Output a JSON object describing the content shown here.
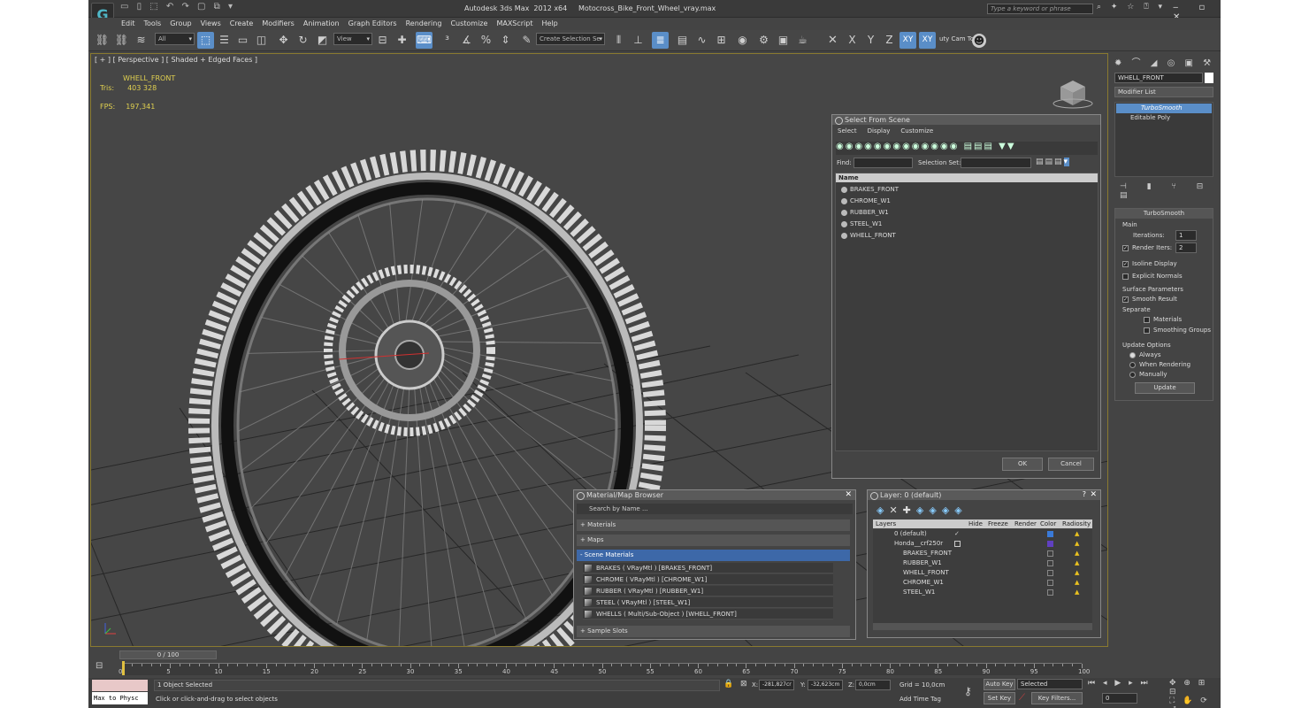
{
  "window": {
    "title": "Autodesk 3ds Max  2012 x64     Motocross_Bike_Front_Wheel_vray.max",
    "search_placeholder": "Type a keyword or phrase"
  },
  "menu": [
    "Edit",
    "Tools",
    "Group",
    "Views",
    "Create",
    "Modifiers",
    "Animation",
    "Graph Editors",
    "Rendering",
    "Customize",
    "MAXScript",
    "Help"
  ],
  "toolbar": {
    "filter": "All",
    "ref_coord": "View",
    "selection_set": "Create Selection Se",
    "axis": {
      "x": "X",
      "y": "Y",
      "z": "Z",
      "xy": "XY",
      "xy2": "XY"
    },
    "plugin_label": "uty Cam Tool"
  },
  "viewport": {
    "label": "[ + ] [ Perspective ] [ Shaded + Edged Faces ]",
    "object_name": "WHELL_FRONT",
    "tris_label": "Tris:",
    "tris_value": "403 328",
    "fps_label": "FPS:",
    "fps_value": "197,341"
  },
  "command_panel": {
    "object_name": "WHELL_FRONT",
    "modifier_list": "Modifier List",
    "stack": [
      "TurboSmooth",
      "Editable Poly"
    ],
    "rollout_title": "TurboSmooth",
    "main_label": "Main",
    "iterations_label": "Iterations:",
    "iterations_value": "1",
    "render_iters_label": "Render Iters:",
    "render_iters_value": "2",
    "isoline": "Isoline Display",
    "explicit_normals": "Explicit Normals",
    "surface_params": "Surface Parameters",
    "smooth_result": "Smooth Result",
    "separate": "Separate",
    "materials": "Materials",
    "smoothing_groups": "Smoothing Groups",
    "update_options": "Update Options",
    "always": "Always",
    "when_rendering": "When Rendering",
    "manually": "Manually",
    "update_btn": "Update"
  },
  "select_from_scene": {
    "title": "Select From Scene",
    "menus": [
      "Select",
      "Display",
      "Customize"
    ],
    "find_label": "Find:",
    "selection_set_label": "Selection Set:",
    "col_name": "Name",
    "items": [
      "BRAKES_FRONT",
      "CHROME_W1",
      "RUBBER_W1",
      "STEEL_W1",
      "WHELL_FRONT"
    ],
    "ok": "OK",
    "cancel": "Cancel"
  },
  "material_browser": {
    "title": "Material/Map Browser",
    "search_placeholder": "Search by Name ...",
    "sections": {
      "materials": "+ Materials",
      "maps": "+ Maps",
      "scene": "- Scene Materials",
      "samples": "+ Sample Slots"
    },
    "scene_materials": [
      "BRAKES  ( VRayMtl )  [BRAKES_FRONT]",
      "CHROME  ( VRayMtl )  [CHROME_W1]",
      "RUBBER  ( VRayMtl )  [RUBBER_W1]",
      "STEEL  ( VRayMtl )  [STEEL_W1]",
      "WHELLS  ( Multi/Sub-Object )  [WHELL_FRONT]"
    ]
  },
  "layer_dialog": {
    "title": "Layer: 0 (default)",
    "help": "?",
    "columns": [
      "Layers",
      "Hide",
      "Freeze",
      "Render",
      "Color",
      "Radiosity"
    ],
    "rows": [
      "0 (default)",
      "Honda__crf250r",
      "BRAKES_FRONT",
      "RUBBER_W1",
      "WHELL_FRONT",
      "CHROME_W1",
      "STEEL_W1"
    ]
  },
  "timeline": {
    "frame": "0 / 100",
    "ticks": [
      "0",
      "5",
      "10",
      "15",
      "20",
      "25",
      "30",
      "35",
      "40",
      "45",
      "50",
      "55",
      "60",
      "65",
      "70",
      "75",
      "80",
      "85",
      "90",
      "95",
      "100"
    ]
  },
  "status": {
    "listener": "Max to Physc",
    "selected": "1 Object Selected",
    "prompt": "Click or click-and-drag to select objects",
    "x_label": "X:",
    "x_value": "-281,827cr",
    "y_label": "Y:",
    "y_value": "-32,623cm",
    "z_label": "Z:",
    "z_value": "0,0cm",
    "grid": "Grid = 10,0cm",
    "add_time_tag": "Add Time Tag",
    "auto_key": "Auto Key",
    "set_key": "Set Key",
    "key_mode": "Selected",
    "key_filters": "Key Filters...",
    "frame_value": "0"
  },
  "colors": {
    "accent": "#5a8ec8",
    "viewport_border": "#8a7a30",
    "stat_text": "#e0d050"
  }
}
